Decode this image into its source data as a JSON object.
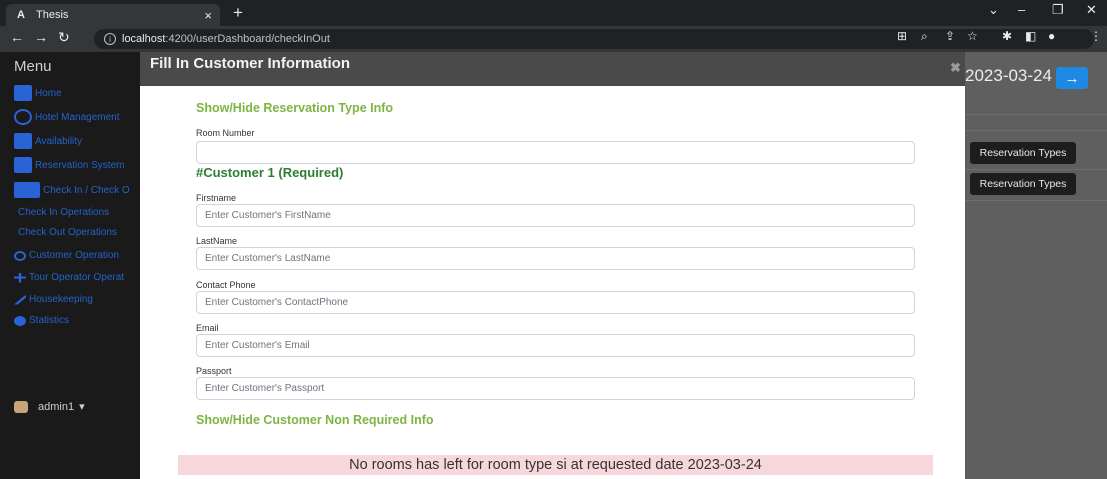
{
  "browser": {
    "tab_title": "Thesis",
    "tab_favicon": "A",
    "url_host": "localhost",
    "url_rest": ":4200/userDashboard/checkInOut"
  },
  "sidebar": {
    "title": "Menu",
    "items": [
      {
        "label": "Home"
      },
      {
        "label": "Hotel Management"
      },
      {
        "label": "Availability"
      },
      {
        "label": "Reservation System"
      },
      {
        "label": "Check In / Check O"
      },
      {
        "label": "Check In Operations"
      },
      {
        "label": "Check Out Operations"
      },
      {
        "label": "Customer Operation"
      },
      {
        "label": "Tour Operator Operat"
      },
      {
        "label": "Housekeeping"
      },
      {
        "label": "Statistics"
      }
    ],
    "user": "admin1",
    "user_caret": "▾"
  },
  "background": {
    "date": "2023-03-24",
    "arrow": "→",
    "button1": "Reservation Types",
    "button2": "Reservation Types"
  },
  "modal": {
    "title": "Fill In Customer Information",
    "close": "✖",
    "toggle_reservation": "Show/Hide Reservation Type Info",
    "room_number_label": "Room Number",
    "room_number_value": "",
    "customer_heading": "#Customer 1 (Required)",
    "fields": [
      {
        "label": "Firstname",
        "placeholder": "Enter Customer's FirstName"
      },
      {
        "label": "LastName",
        "placeholder": "Enter Customer's LastName"
      },
      {
        "label": "Contact Phone",
        "placeholder": "Enter Customer's ContactPhone"
      },
      {
        "label": "Email",
        "placeholder": "Enter Customer's Email"
      },
      {
        "label": "Passport",
        "placeholder": "Enter Customer's Passport"
      }
    ],
    "toggle_non_required": "Show/Hide Customer Non Required Info",
    "alert": "No rooms has left for room type si at requested date 2023-03-24"
  }
}
